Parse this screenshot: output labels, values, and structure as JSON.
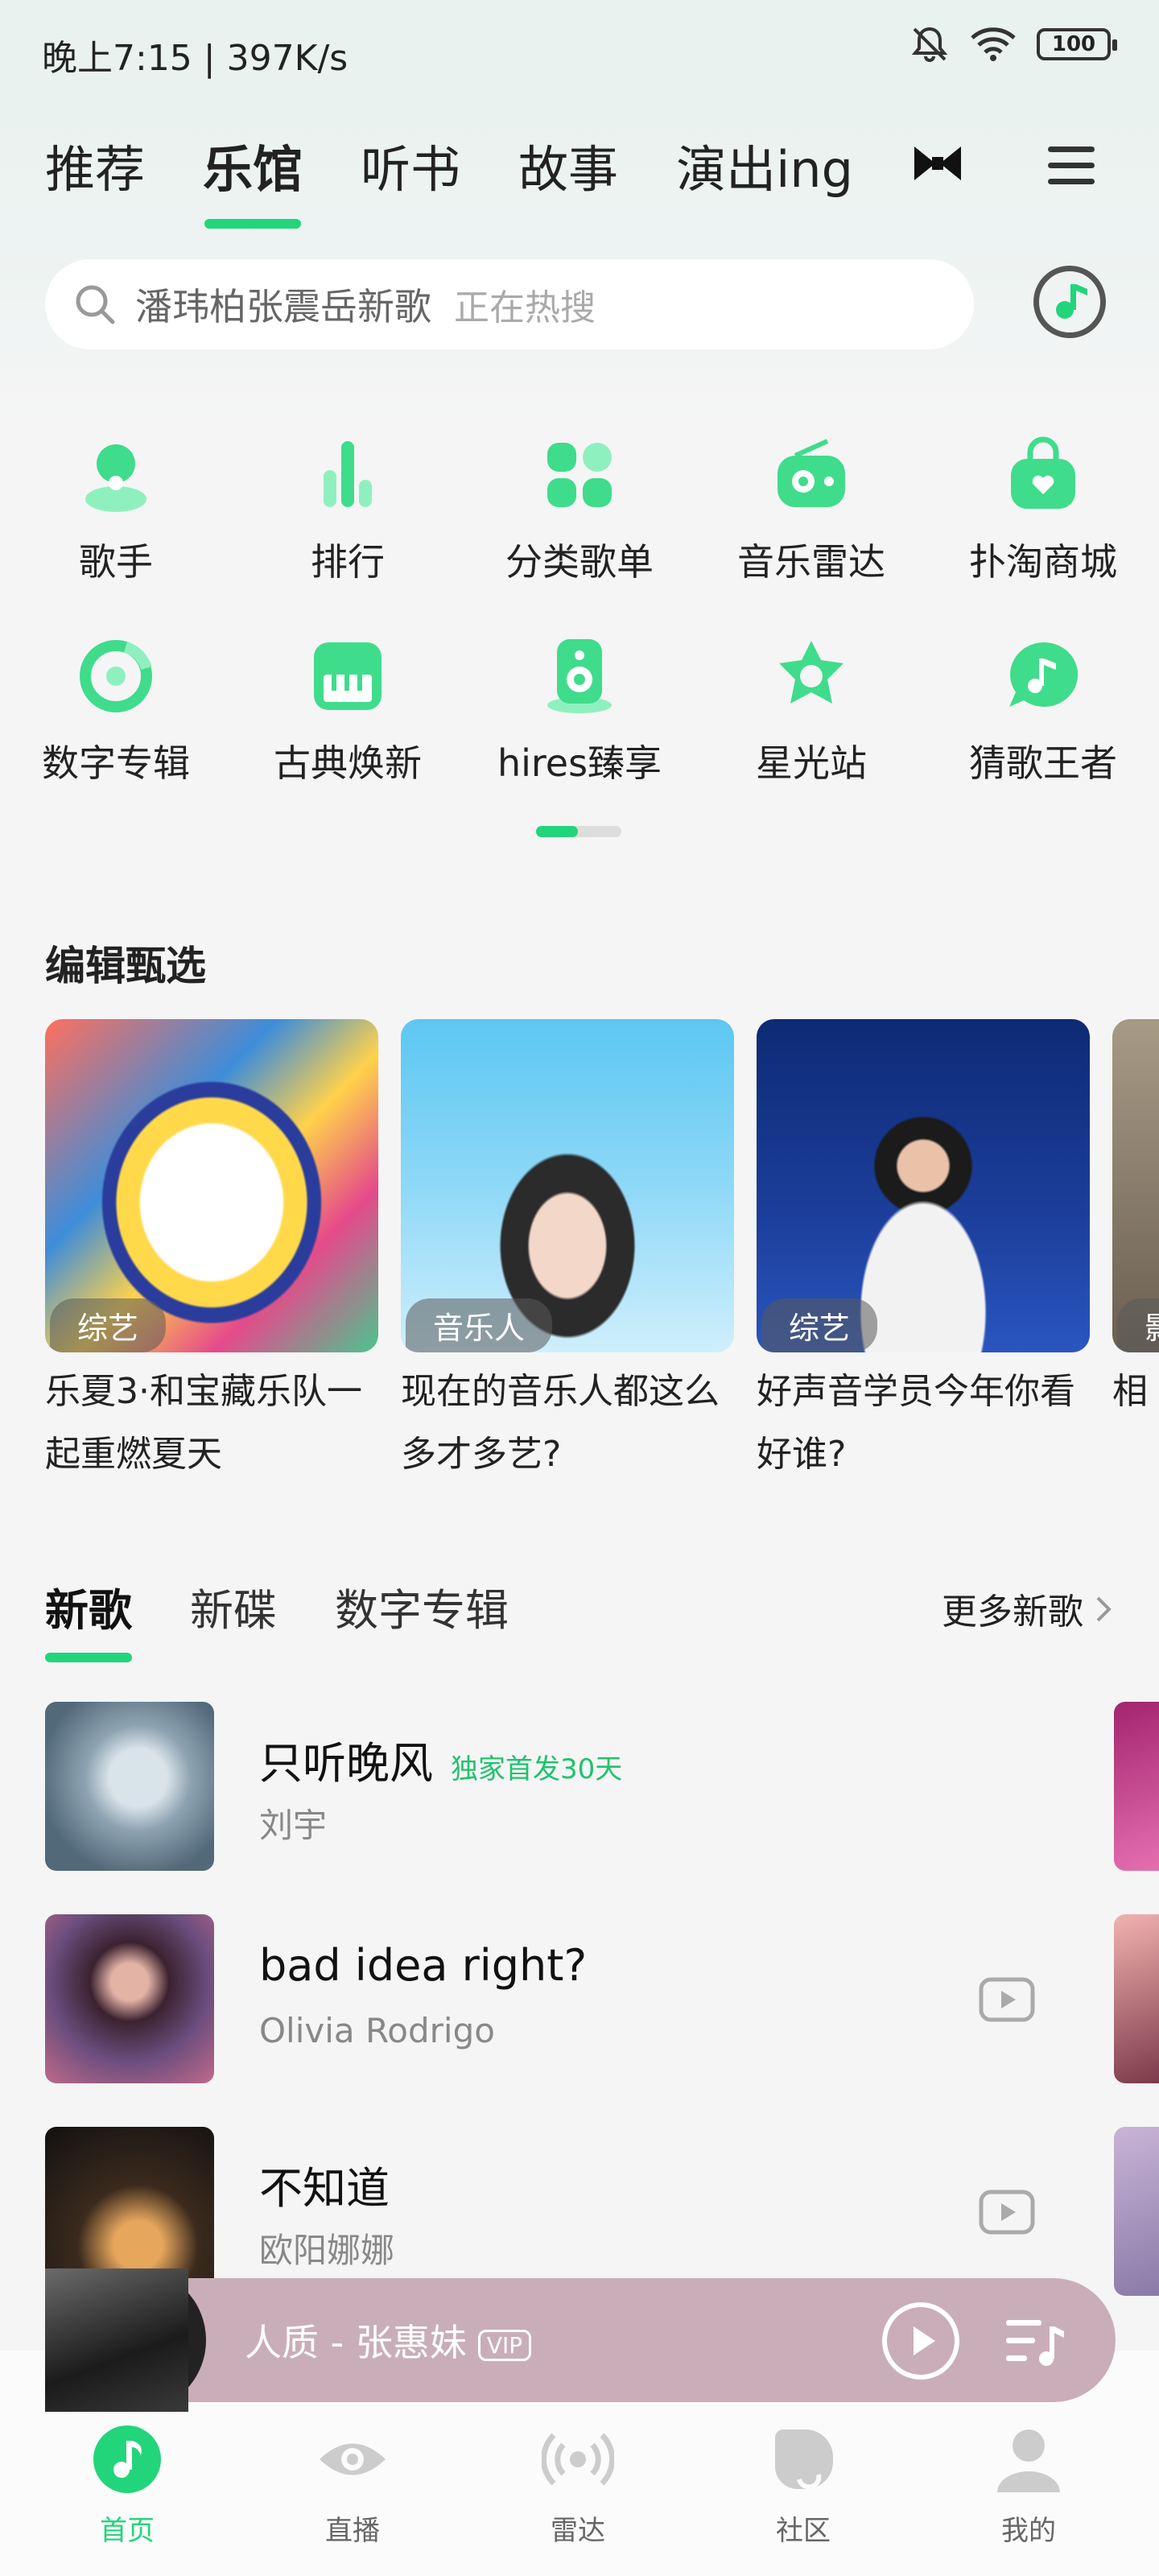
{
  "status_bar": {
    "time_speed": "晚上7:15 | 397K/s",
    "battery": "100"
  },
  "top_tabs": [
    {
      "label": "推荐",
      "active": false
    },
    {
      "label": "乐馆",
      "active": true
    },
    {
      "label": "听书",
      "active": false
    },
    {
      "label": "故事",
      "active": false
    },
    {
      "label": "演出ing",
      "active": false
    }
  ],
  "search": {
    "placeholder": "潘玮柏张震岳新歌",
    "hot_label": "正在热搜"
  },
  "categories": [
    {
      "label": "歌手",
      "icon": "singer-icon"
    },
    {
      "label": "排行",
      "icon": "chart-icon"
    },
    {
      "label": "分类歌单",
      "icon": "playlist-grid-icon"
    },
    {
      "label": "音乐雷达",
      "icon": "radio-icon"
    },
    {
      "label": "扑淘商城",
      "icon": "shopping-bag-icon"
    },
    {
      "label": "数字专辑",
      "icon": "disc-icon"
    },
    {
      "label": "古典焕新",
      "icon": "piano-icon"
    },
    {
      "label": "hires臻享",
      "icon": "speaker-icon"
    },
    {
      "label": "星光站",
      "icon": "star-icon"
    },
    {
      "label": "猜歌王者",
      "icon": "music-chat-icon"
    }
  ],
  "editor_picks": {
    "title": "编辑甄选",
    "cards": [
      {
        "tag": "综艺",
        "caption": "乐夏3·和宝藏乐队一起重燃夏天"
      },
      {
        "tag": "音乐人",
        "caption": "现在的音乐人都这么多才多艺?"
      },
      {
        "tag": "综艺",
        "caption": "好声音学员今年你看好谁?"
      },
      {
        "tag": "影",
        "caption": "相"
      }
    ]
  },
  "new_section": {
    "tabs": [
      "新歌",
      "新碟",
      "数字专辑"
    ],
    "more": "更多新歌",
    "songs": [
      {
        "title": "只听晚风",
        "badge": "独家首发30天",
        "artist": "刘宇"
      },
      {
        "title": "bad idea right?",
        "badge": "",
        "artist": "Olivia Rodrigo"
      },
      {
        "title": "不知道",
        "badge": "",
        "artist": "欧阳娜娜"
      }
    ]
  },
  "player": {
    "now_playing": "人质 - 张惠妹",
    "vip": "VIP"
  },
  "bottom_nav": [
    {
      "label": "首页",
      "active": true
    },
    {
      "label": "直播",
      "active": false
    },
    {
      "label": "雷达",
      "active": false
    },
    {
      "label": "社区",
      "active": false
    },
    {
      "label": "我的",
      "active": false
    }
  ],
  "colors": {
    "accent": "#22d57a",
    "player_bg": "#c9aeb9"
  }
}
